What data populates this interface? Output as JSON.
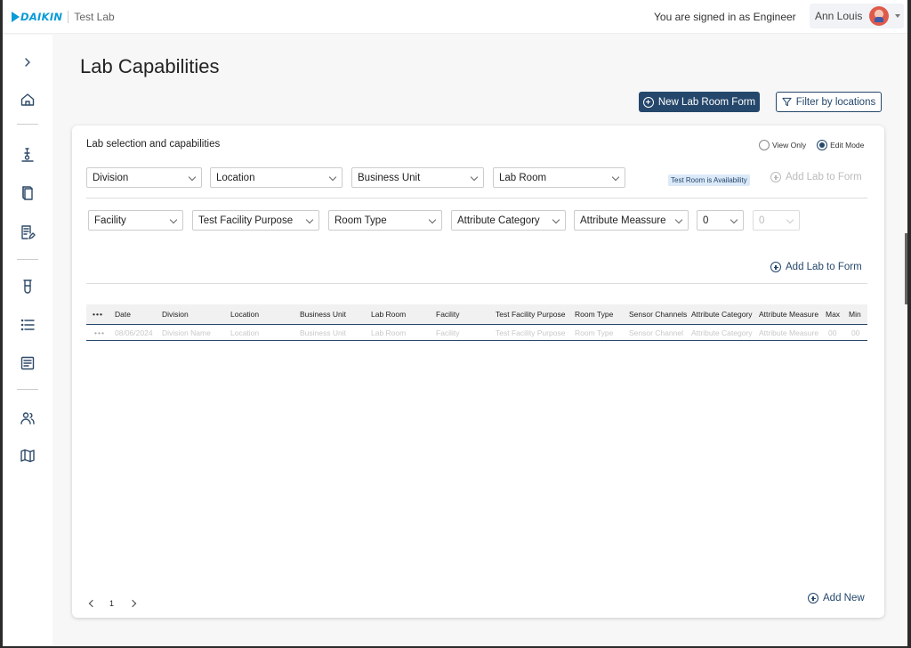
{
  "header": {
    "brand": "DAIKIN",
    "app_name": "Test Lab",
    "signed_in_text": "You are signed in as Engineer",
    "user_name": "Ann Louis"
  },
  "sidebar": {
    "items": [
      {
        "icon": "chevron-right-icon"
      },
      {
        "icon": "home-icon"
      },
      {
        "icon": "microscope-icon"
      },
      {
        "icon": "book-icon"
      },
      {
        "icon": "document-edit-icon"
      },
      {
        "icon": "test-tube-icon"
      },
      {
        "icon": "list-icon"
      },
      {
        "icon": "document-icon"
      },
      {
        "icon": "users-icon"
      },
      {
        "icon": "map-icon"
      }
    ]
  },
  "page": {
    "title": "Lab Capabilities",
    "new_form_label": "New Lab Room Form",
    "filter_label": "Filter by locations"
  },
  "card": {
    "title": "Lab selection and capabilities",
    "view_only_label": "View Only",
    "edit_mode_label": "Edit Mode",
    "mode_selected": "Edit Mode",
    "row1_filters": [
      "Division",
      "Location",
      "Business Unit",
      "Lab Room"
    ],
    "availability_badge": "Test Room is Availability",
    "add_lab_label": "Add Lab to Form",
    "row2_filters": [
      "Facility",
      "Test Facility Purpose",
      "Room Type",
      "Attribute Category",
      "Attribute Meassure",
      "0",
      "0"
    ],
    "add_lab_label_2": "Add Lab to Form"
  },
  "table": {
    "more": "•••",
    "columns": [
      "Date",
      "Division",
      "Location",
      "Business Unit",
      "Lab Room",
      "Facility",
      "Test Facility Purpose",
      "Room Type",
      "Sensor Channels",
      "Attribute Category",
      "Attribute Measure",
      "Max",
      "Min"
    ],
    "rows": [
      {
        "more": "•••",
        "cells": [
          "08/06/2024",
          "Division Name",
          "Location",
          "Business Unit",
          "Lab Room",
          "Facility",
          "Test Facility Purpose",
          "Room Type",
          "Sensor Channel",
          "Attribute Category",
          "Attribute Measure",
          "00",
          "00"
        ]
      }
    ]
  },
  "pager": {
    "page": "1"
  },
  "add_new_label": "Add New",
  "colors": {
    "accent": "#25476b",
    "brand": "#0a9ad7",
    "badge_bg": "#dbe9f8"
  }
}
